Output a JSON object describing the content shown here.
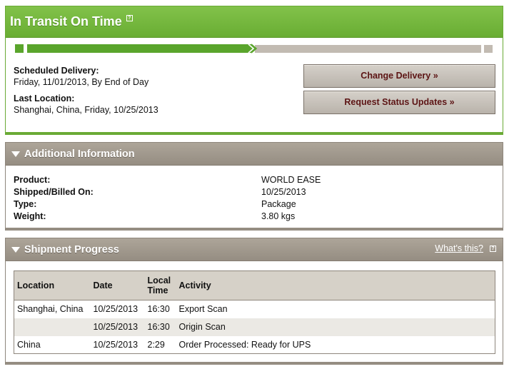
{
  "status": {
    "title": "In Transit On Time",
    "help_mark": "?",
    "progress_fraction": 0.5,
    "scheduled_label": "Scheduled Delivery:",
    "scheduled_value": "Friday, 11/01/2013, By End of Day",
    "last_location_label": "Last Location:",
    "last_location_value": "Shanghai, China, Friday, 10/25/2013",
    "change_delivery_label": "Change Delivery »",
    "request_updates_label": "Request Status Updates »"
  },
  "additional": {
    "title": "Additional Information",
    "rows": [
      {
        "label": "Product:",
        "value": "WORLD EASE"
      },
      {
        "label": "Shipped/Billed On:",
        "value": "10/25/2013"
      },
      {
        "label": "Type:",
        "value": "Package"
      },
      {
        "label": "Weight:",
        "value": "3.80 kgs"
      }
    ]
  },
  "progress": {
    "title": "Shipment Progress",
    "whats_this": "What's this?",
    "help_mark": "?",
    "columns": {
      "location": "Location",
      "date": "Date",
      "local_time_1": "Local",
      "local_time_2": "Time",
      "activity": "Activity"
    },
    "rows": [
      {
        "location": "Shanghai, China",
        "date": "10/25/2013",
        "time": "16:30",
        "activity": "Export Scan"
      },
      {
        "location": "",
        "date": "10/25/2013",
        "time": "16:30",
        "activity": "Origin Scan"
      },
      {
        "location": "China",
        "date": "10/25/2013",
        "time": "2:29",
        "activity": "Order Processed: Ready for UPS"
      }
    ]
  },
  "colors": {
    "status_green": "#69ad33",
    "section_taupe": "#958d82",
    "button_text": "#5c1414"
  }
}
